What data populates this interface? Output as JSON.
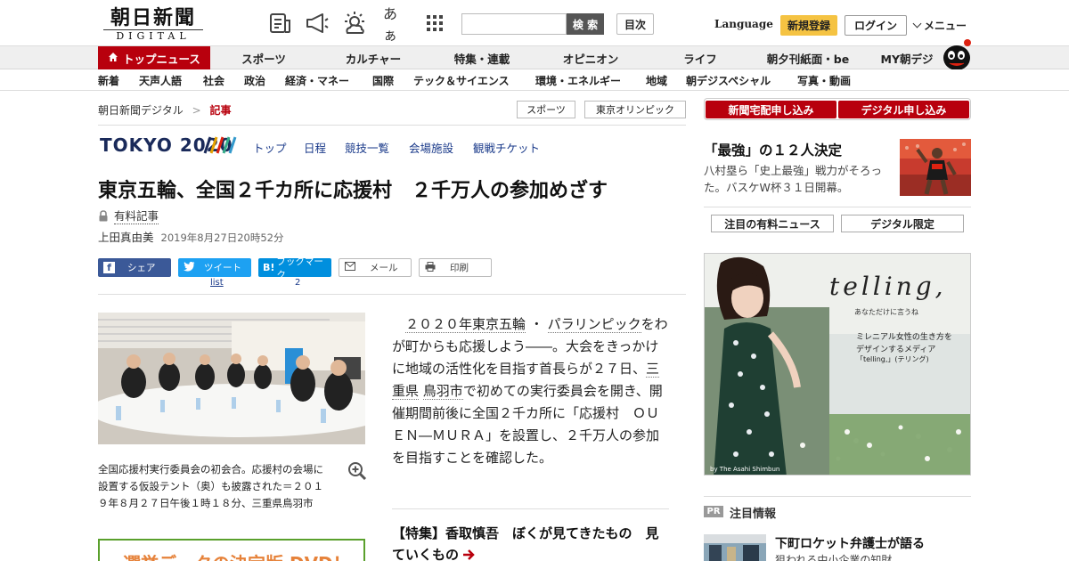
{
  "header": {
    "logo_kanji": "朝日新聞",
    "logo_sub": "DIGITAL",
    "search_placeholder": "",
    "search_label": "検 索",
    "toc_label": "目次",
    "language_label": "Language",
    "register_label": "新規登録",
    "login_label": "ログイン",
    "menu_label": "メニュー",
    "font_size_icon_text": "あぁ"
  },
  "main_nav": {
    "items": [
      "トップニュース",
      "スポーツ",
      "カルチャー",
      "特集・連載",
      "オピニオン",
      "ライフ",
      "朝夕刊紙面・be",
      "MY朝デジ"
    ]
  },
  "sub_nav": {
    "items": [
      "新着",
      "天声人語",
      "社会",
      "政治",
      "経済・マネー",
      "国際",
      "テック＆サイエンス",
      "環境・エネルギー",
      "地域",
      "朝デジスペシャル",
      "写真・動画"
    ]
  },
  "breadcrumb": {
    "home": "朝日新聞デジタル",
    "sep": ">",
    "current": "記事"
  },
  "tags": [
    "スポーツ",
    "東京オリンピック"
  ],
  "tokyo2020": {
    "logo": "TOKYO 2020",
    "links": [
      "トップ",
      "日程",
      "競技一覧",
      "会場施設",
      "観戦チケット"
    ]
  },
  "article": {
    "headline": "東京五輪、全国２千カ所に応援村　２千万人の参加めざす",
    "paid_label": "有料記事",
    "author": "上田真由美",
    "date": "2019年8月27日20時52分",
    "caption": "全国応援村実行委員会の初会合。応援村の会場に設置する仮設テント（奥）も披露された＝２０１９年８月２７日午後１時１８分、三重県鳥羽市",
    "body_parts": [
      "　",
      "２０２０年東京五輪",
      "・",
      "パラリンピック",
      "をわが町からも応援しよう――。大会をきっかけに地域の活性化を目指す首長らが２７日、",
      "三重県",
      " ",
      "鳥羽市",
      "で初めての実行委員会を開き、開催期間前後に全国２千カ所に「応援村　ＯＵＥＮ―ＭＵＲＡ」を設置し、２千万人の参加を目指すことを確認した。"
    ],
    "feature_link": "【特集】香取慎吾　ぼくが見てきたもの　見ていくもの",
    "dvd_banner": "選挙データの決定版 DVD！"
  },
  "share": {
    "facebook": "シェア",
    "twitter": "ツイート",
    "twitter_count": "list",
    "hatena": "ブックマーク",
    "hatena_count": "2",
    "mail": "メール",
    "print": "印刷"
  },
  "sidebar": {
    "subscribe_paper": "新聞宅配申し込み",
    "subscribe_digital": "デジタル申し込み",
    "news_title": "「最強」の１２人決定",
    "news_desc": "八村塁ら「史上最強」戦力がそろった。バスケW杯３１日開幕。",
    "tab_paid": "注目の有料ニュース",
    "tab_digital": "デジタル限定",
    "ad": {
      "brand": "telling,",
      "tagline": "あなただけに言うね",
      "copy1": "ミレニアル女性の生き方を",
      "copy2": "デザインするメディア",
      "copy3": "「telling,」(テリング)",
      "credit": "by The Asahi Shimbun"
    },
    "pr_badge": "PR",
    "pr_title": "注目情報",
    "pr_headline": "下町ロケット弁護士が語る",
    "pr_sub": "狙われる中小企業の知財"
  },
  "colors": {
    "brand_red": "#b8000d",
    "register_yellow": "#f5c342",
    "link_blue": "#1a3a8a"
  }
}
